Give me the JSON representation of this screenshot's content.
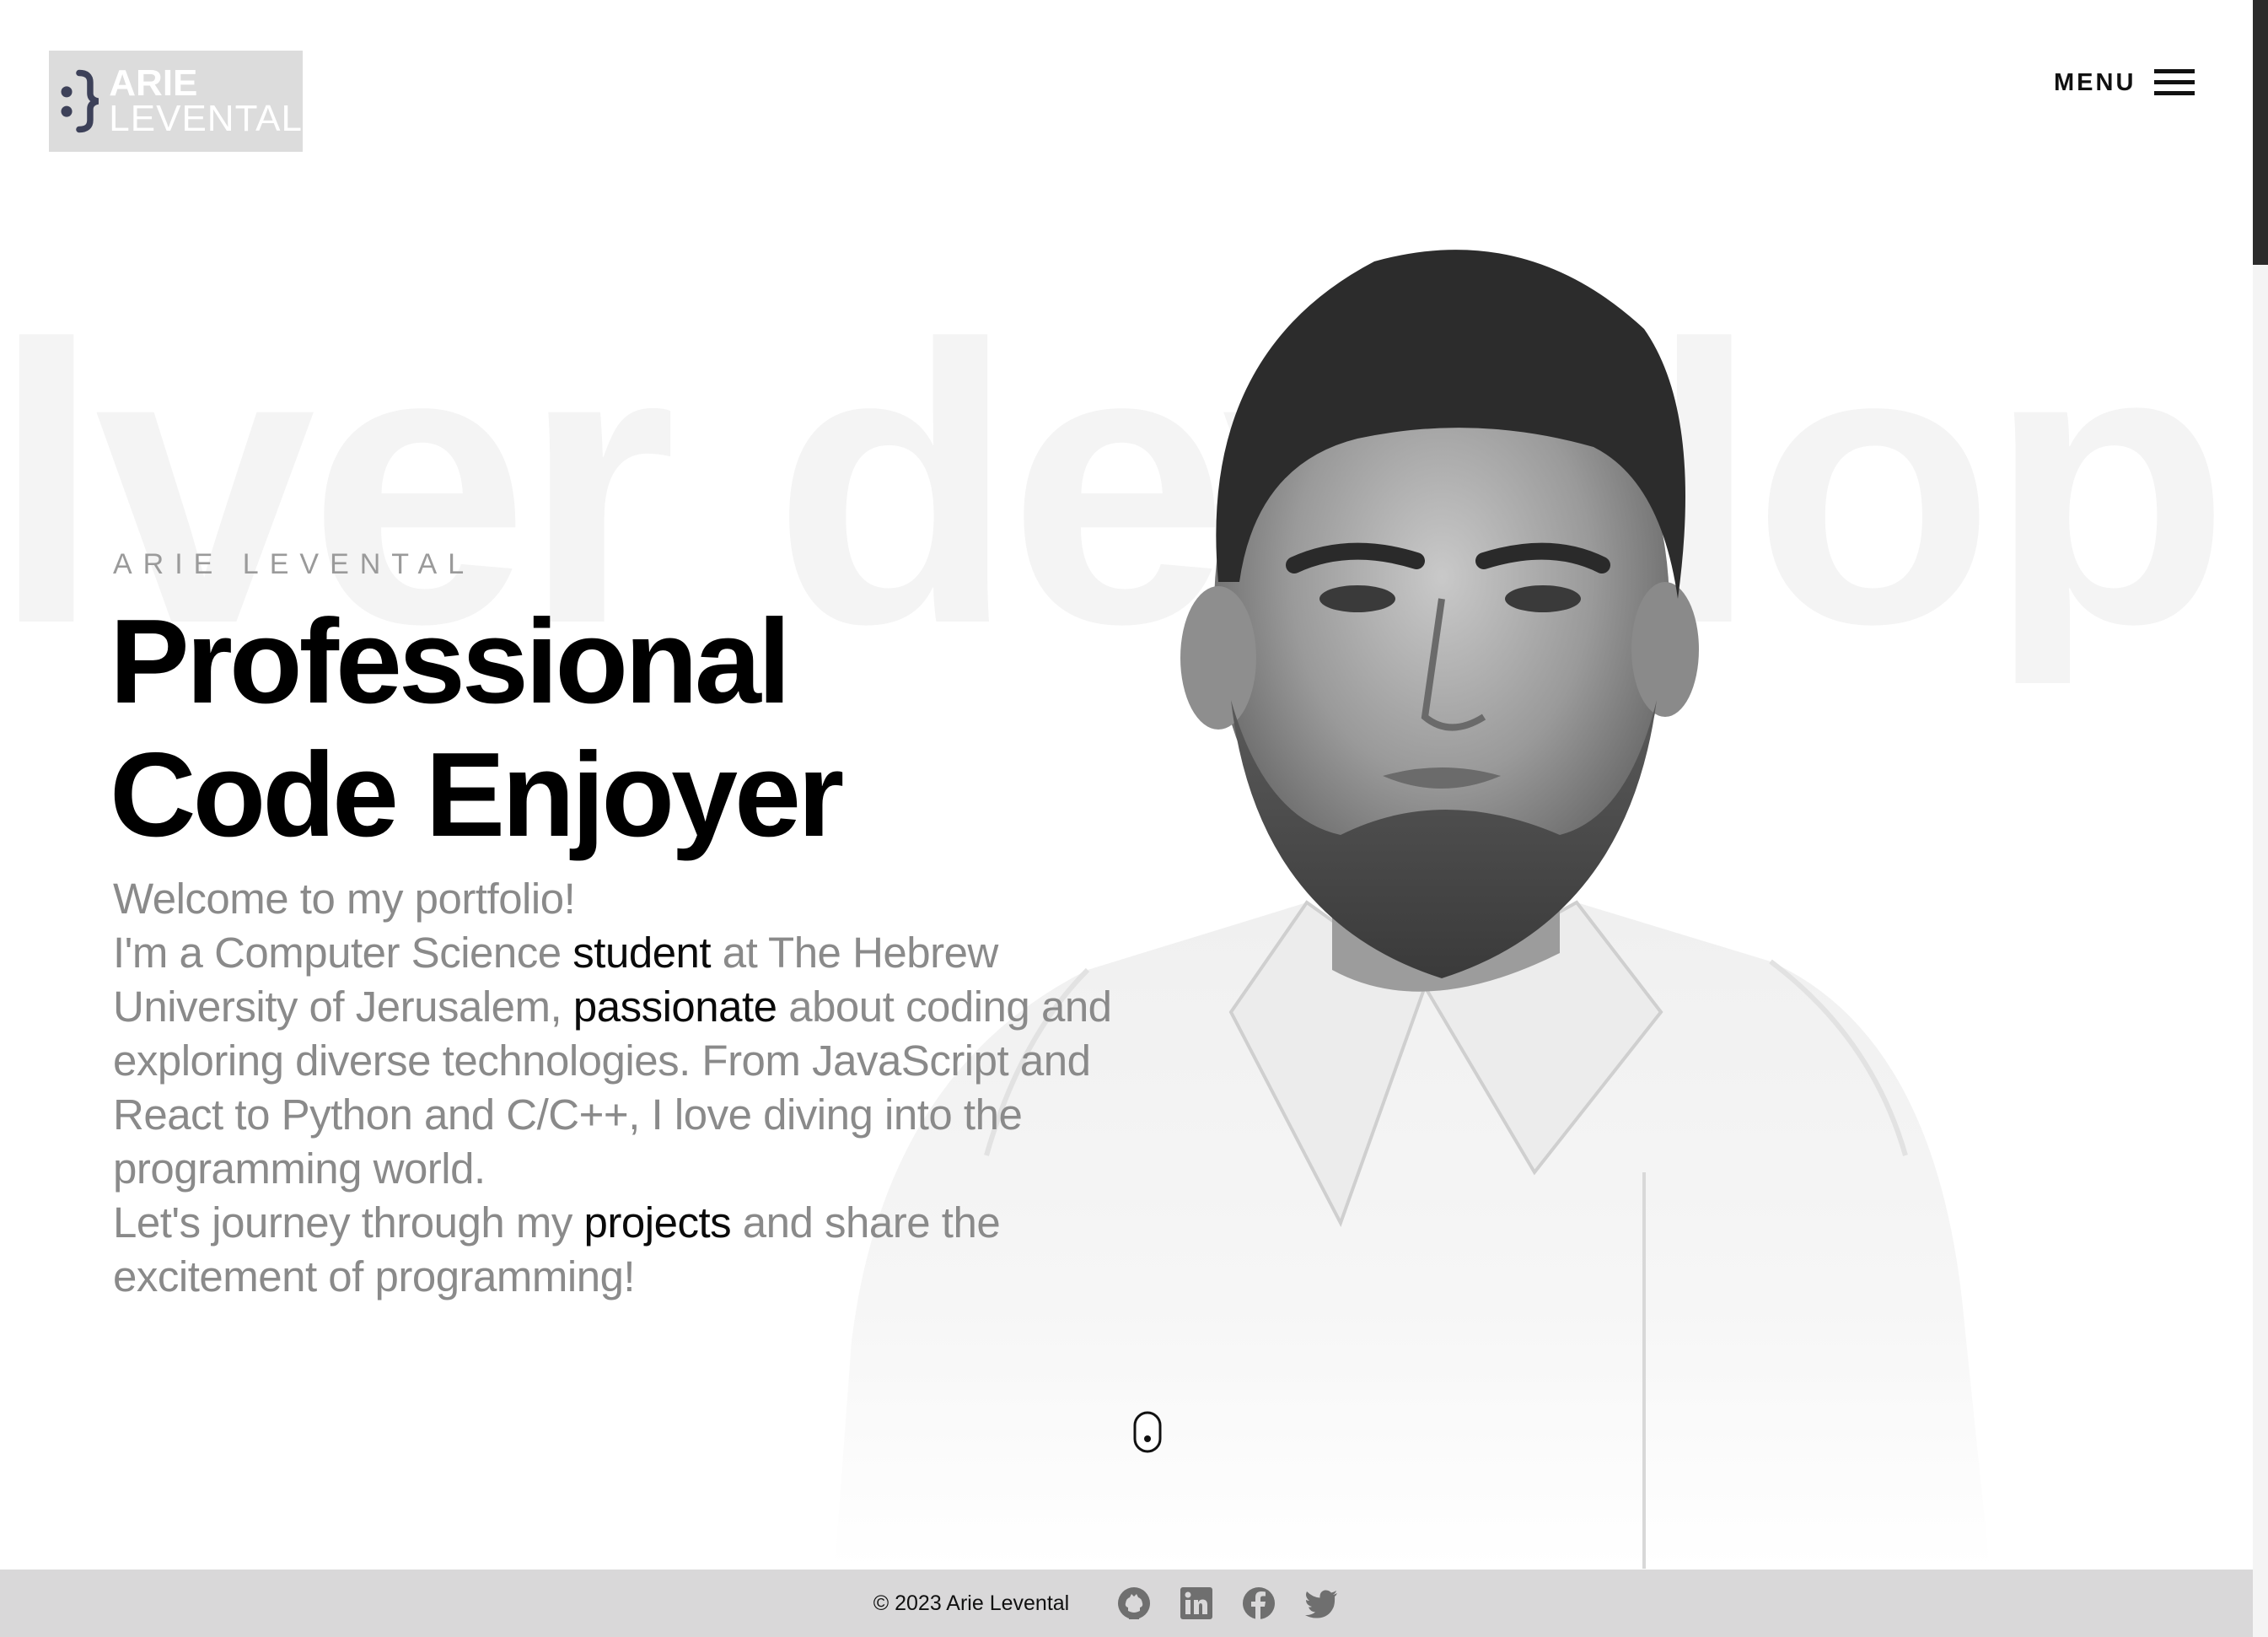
{
  "background_word": "lver developer",
  "logo": {
    "first": "ARIE",
    "last": "LEVENTAL"
  },
  "menu": {
    "label": "MENU"
  },
  "hero": {
    "kicker": "ARIE LEVENTAL",
    "headline_line1": "Professional",
    "headline_line2": "Code Enjoyer"
  },
  "intro": {
    "welcome": "Welcome to my portfolio!",
    "p2_part1": "I'm a Computer Science ",
    "p2_hl1": "student",
    "p2_part2": " at The Hebrew University of Jerusalem, ",
    "p2_hl2": "passionate",
    "p2_part3": " about coding and exploring diverse technologies. From JavaScript and React to Python and C/C++, I love diving into the programming world.",
    "p3_part1": "Let's journey through my ",
    "p3_hl": "projects",
    "p3_part2": " and share the excitement of programming!"
  },
  "footer": {
    "copyright": "© 2023 Arie Levental",
    "social": [
      "github-icon",
      "linkedin-icon",
      "facebook-icon",
      "twitter-icon"
    ]
  },
  "colors": {
    "accent_dark": "#3d4159",
    "logo_bg": "#dcdcdc",
    "muted_text": "#8a8a8a",
    "footer_bg": "#d9d8d9",
    "social_icon": "#6f6f6f"
  }
}
